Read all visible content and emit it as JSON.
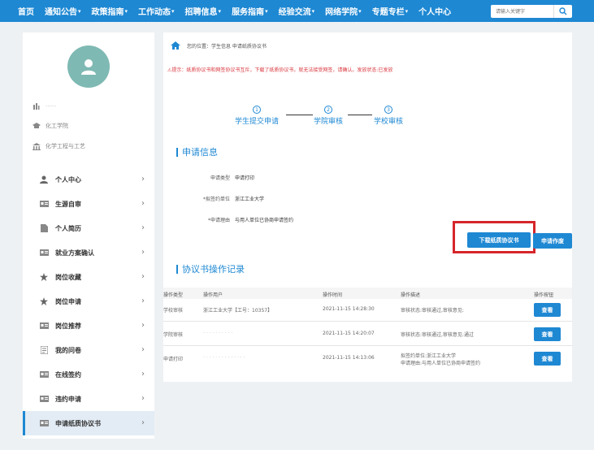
{
  "nav": {
    "items": [
      {
        "label": "首页",
        "caret": ""
      },
      {
        "label": "通知公告",
        "caret": "▾"
      },
      {
        "label": "政策指南",
        "caret": "▾"
      },
      {
        "label": "工作动态",
        "caret": "▾"
      },
      {
        "label": "招聘信息",
        "caret": "▾"
      },
      {
        "label": "服务指南",
        "caret": "▾"
      },
      {
        "label": "经验交流",
        "caret": "▾"
      },
      {
        "label": "网络学院",
        "caret": "▾"
      },
      {
        "label": "专题专栏",
        "caret": "▾"
      },
      {
        "label": "个人中心",
        "caret": ""
      }
    ],
    "search_placeholder": "请输入关键字"
  },
  "sidebar": {
    "info": [
      {
        "icon": "building-icon",
        "text": "······"
      },
      {
        "icon": "graduation-cap-icon",
        "text": "化工学院"
      },
      {
        "icon": "bank-icon",
        "text": "化学工程与工艺"
      }
    ],
    "menu": [
      {
        "label": "个人中心",
        "icon": "user-icon"
      },
      {
        "label": "生源自审",
        "icon": "id-card-icon"
      },
      {
        "label": "个人简历",
        "icon": "file-icon"
      },
      {
        "label": "就业方案确认",
        "icon": "id-card-icon"
      },
      {
        "label": "岗位收藏",
        "icon": "star-icon"
      },
      {
        "label": "岗位申请",
        "icon": "star-icon"
      },
      {
        "label": "岗位推荐",
        "icon": "id-card-icon"
      },
      {
        "label": "我的问卷",
        "icon": "document-icon"
      },
      {
        "label": "在线签约",
        "icon": "id-card-icon"
      },
      {
        "label": "违约申请",
        "icon": "id-card-icon"
      },
      {
        "label": "申请纸质协议书",
        "icon": "id-card-icon"
      }
    ],
    "chevron": "›"
  },
  "main": {
    "breadcrumb": "您的位置：学生信息 申请纸质协议书",
    "notice": "⚠提示：纸质协议书和网签协议书互斥，下载了纸质协议书，就无法接受网签，请确认。发放状态:已发放",
    "steps": [
      {
        "num": "1",
        "label": "学生提交申请"
      },
      {
        "num": "2",
        "label": "学院审核"
      },
      {
        "num": "3",
        "label": "学校审核"
      }
    ],
    "apply_title": "申请信息",
    "form": [
      {
        "key": "申请类型",
        "value": "申请打印"
      },
      {
        "key": "*拟签约单位",
        "value": "浙江工业大学"
      },
      {
        "key": "*申请理由",
        "value": "与用人单位已协商申请签约"
      }
    ],
    "download_button": "下载纸质协议书",
    "void_button": "申请作废",
    "log_title": "协议书操作记录",
    "table": {
      "headers": [
        "操作类型",
        "操作用户",
        "操作时间",
        "操作描述",
        "操作按钮"
      ],
      "rows": [
        {
          "type": "学校审核",
          "user": "浙江工业大学【工号：10357】",
          "time": "2021-11-15 14:28:30",
          "desc1": "审核状态:审核通过,审核意见:",
          "desc2": "",
          "action": "查看"
        },
        {
          "type": "学院审核",
          "user": "· · · · · · · · · ·",
          "time": "2021-11-15 14:20:07",
          "desc1": "审核状态:审核通过,审核意见:通过",
          "desc2": "",
          "action": "查看"
        },
        {
          "type": "申请打印",
          "user": "· · · · · · · · · · · · · ·",
          "time": "2021-11-15 14:13:06",
          "desc1": "拟签约单位:浙江工业大学",
          "desc2": "申请理由:与用人单位已协商申请签约",
          "action": "查看"
        }
      ]
    }
  },
  "colors": {
    "primary": "#1e88d3",
    "highlight": "#d6262b",
    "notice": "#d9363e",
    "avatar": "#7fb9b3"
  }
}
